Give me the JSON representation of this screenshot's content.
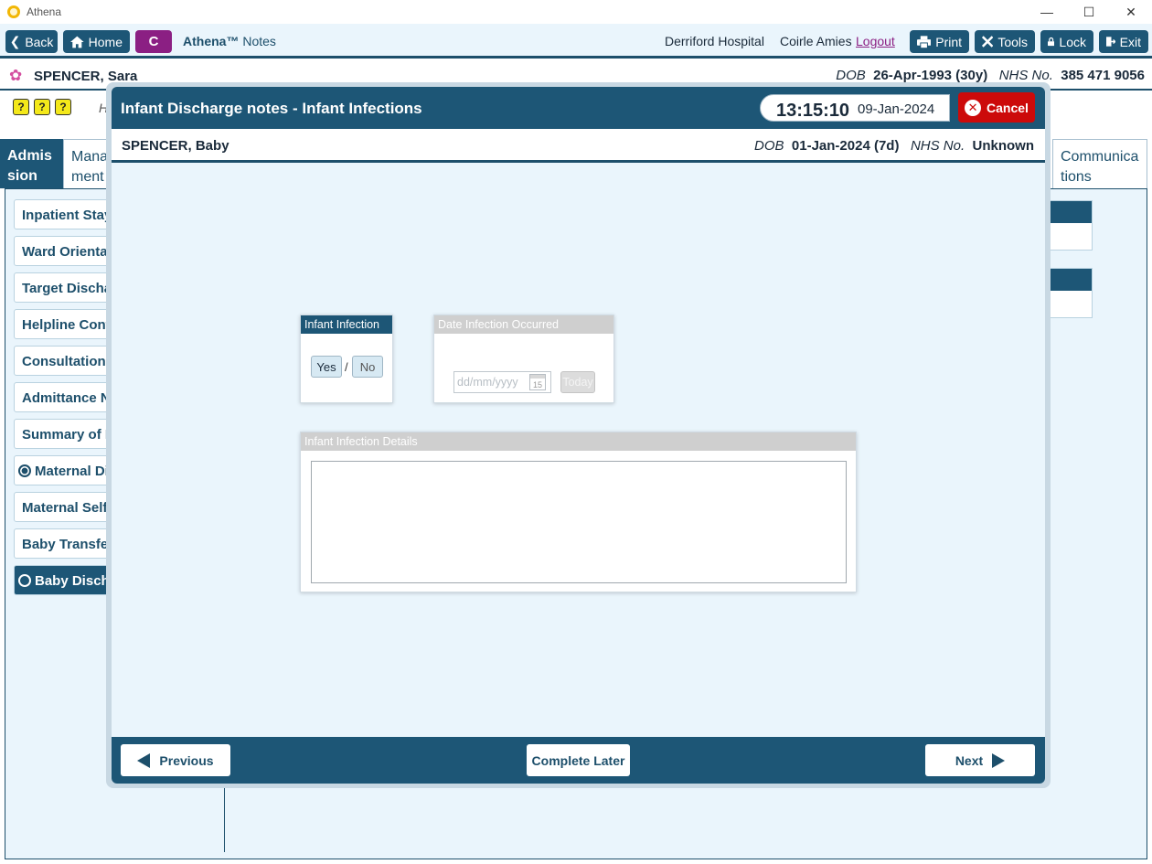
{
  "window": {
    "title": "Athena",
    "controls": [
      "—",
      "☐",
      "✕"
    ]
  },
  "toolbar": {
    "back": "Back",
    "home": "Home",
    "c_button": "C",
    "brand_strong": "Athena™",
    "brand_rest": " Notes",
    "hospital": "Derriford Hospital",
    "user": "Coirle Amies",
    "logout": "Logout",
    "print": "Print",
    "tools": "Tools",
    "lock": "Lock",
    "exit": "Exit"
  },
  "patient": {
    "name": "SPENCER, Sara",
    "dob_label": "DOB",
    "dob_value": "26-Apr-1993 (30y)",
    "nhs_label": "NHS No.",
    "nhs_value": "385 471 9056"
  },
  "help_icons": [
    "?",
    "?",
    "?"
  ],
  "help_caption": "H",
  "tabs": [
    {
      "label": "Admis sion",
      "active": true
    },
    {
      "label": "Mana ment",
      "active": false
    },
    {
      "label": "Communica tions",
      "active": false
    }
  ],
  "nav_items": [
    {
      "label": "Inpatient Stay",
      "radio": "none",
      "selected": false
    },
    {
      "label": "Ward Orientat",
      "radio": "none",
      "selected": false
    },
    {
      "label": "Target Dischar",
      "radio": "none",
      "selected": false
    },
    {
      "label": "Helpline Cont",
      "radio": "none",
      "selected": false
    },
    {
      "label": "Consultation I",
      "radio": "none",
      "selected": false
    },
    {
      "label": "Admittance N",
      "radio": "none",
      "selected": false
    },
    {
      "label": "Summary of P",
      "radio": "none",
      "selected": false
    },
    {
      "label": "Maternal Di",
      "radio": "on",
      "selected": false
    },
    {
      "label": "Maternal Self",
      "radio": "none",
      "selected": false
    },
    {
      "label": "Baby Transfer",
      "radio": "none",
      "selected": false
    },
    {
      "label": "Baby Discha",
      "radio": "off",
      "selected": true
    }
  ],
  "modal": {
    "title": "Infant Discharge notes - Infant Infections",
    "time": "13:15:10",
    "date": "09-Jan-2024",
    "cancel": "Cancel",
    "baby": {
      "name": "SPENCER, Baby",
      "dob_label": "DOB",
      "dob_value": "01-Jan-2024 (7d)",
      "nhs_label": "NHS No.",
      "nhs_value": "Unknown"
    },
    "infection_card": {
      "header": "Infant Infection",
      "yes": "Yes",
      "slash": "/",
      "no": "No"
    },
    "date_card": {
      "header": "Date Infection Occurred",
      "placeholder": "dd/mm/yyyy",
      "cal_day": "15",
      "today": "Today"
    },
    "details_card": {
      "header": "Infant Infection Details",
      "value": ""
    },
    "footer": {
      "previous": "Previous",
      "complete_later": "Complete Later",
      "next": "Next"
    }
  },
  "colors": {
    "primary": "#1d5676",
    "accent_purple": "#8b1f83",
    "cancel_red": "#cc0a0a",
    "panel_bg": "#eaf5fc"
  }
}
